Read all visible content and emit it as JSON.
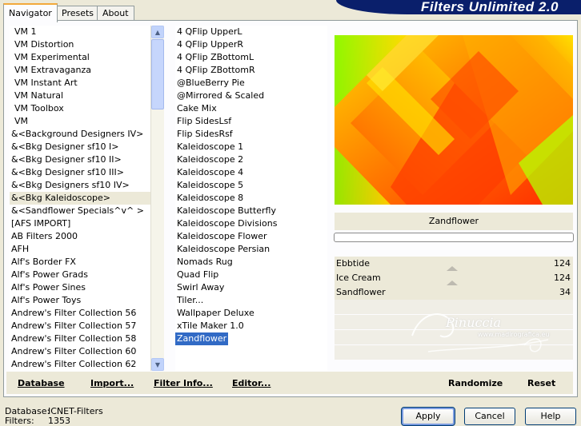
{
  "tabs": [
    "Navigator",
    "Presets",
    "About"
  ],
  "banner_title": "Filters Unlimited 2.0",
  "categories": [
    "VM 1",
    "VM Distortion",
    "VM Experimental",
    "VM Extravaganza",
    "VM Instant Art",
    "VM Natural",
    "VM Toolbox",
    "VM",
    "&<Background Designers IV>",
    "&<Bkg Designer sf10 I>",
    "&<Bkg Designer sf10 II>",
    "&<Bkg Designer sf10 III>",
    "&<Bkg Designers sf10 IV>",
    "&<Bkg Kaleidoscope>",
    "&<Sandflower Specials^v^ >",
    "[AFS IMPORT]",
    "AB Filters 2000",
    "AFH",
    "Alf's Border FX",
    "Alf's Power Grads",
    "Alf's Power Sines",
    "Alf's Power Toys",
    "Andrew's Filter Collection 56",
    "Andrew's Filter Collection 57",
    "Andrew's Filter Collection 58",
    "Andrew's Filter Collection 60",
    "Andrew's Filter Collection 62"
  ],
  "selected_category": "&<Bkg Kaleidoscope>",
  "filters": [
    "4 QFlip UpperL",
    "4 QFlip UpperR",
    "4 QFlip ZBottomL",
    "4 QFlip ZBottomR",
    "@BlueBerry Pie",
    "@Mirrored & Scaled",
    "Cake Mix",
    "Flip SidesLsf",
    "Flip SidesRsf",
    "Kaleidoscope 1",
    "Kaleidoscope 2",
    "Kaleidoscope 4",
    "Kaleidoscope 5",
    "Kaleidoscope 8",
    "Kaleidoscope Butterfly",
    "Kaleidoscope Divisions",
    "Kaleidoscope Flower",
    "Kaleidoscope Persian",
    "Nomads Rug",
    "Quad Flip",
    "Swirl Away",
    "Tiler...",
    "Wallpaper Deluxe",
    "xTile Maker 1.0",
    "Zandflower"
  ],
  "selected_filter": "Zandflower",
  "filter_name": "Zandflower",
  "params": [
    {
      "label": "Ebbtide",
      "value": "124"
    },
    {
      "label": "Ice Cream",
      "value": "124"
    },
    {
      "label": "Sandflower",
      "value": "34"
    }
  ],
  "watermark": "Pinuccia",
  "watermark_url": "www.madirografica.eu",
  "actions": {
    "database": "Database",
    "import": "Import...",
    "filter_info": "Filter Info...",
    "editor": "Editor...",
    "randomize": "Randomize",
    "reset": "Reset"
  },
  "footer": {
    "database_label": "Database:",
    "database_value": "ICNET-Filters",
    "filters_label": "Filters:",
    "filters_value": "1353"
  },
  "buttons": {
    "apply": "Apply",
    "cancel": "Cancel",
    "help": "Help"
  },
  "colors": {
    "window_bg": "#ece9d8",
    "selection_blue": "#316ac5",
    "banner_navy": "#0a1f6b",
    "preview_orange": "#ff8800",
    "preview_green": "#66ff00"
  }
}
